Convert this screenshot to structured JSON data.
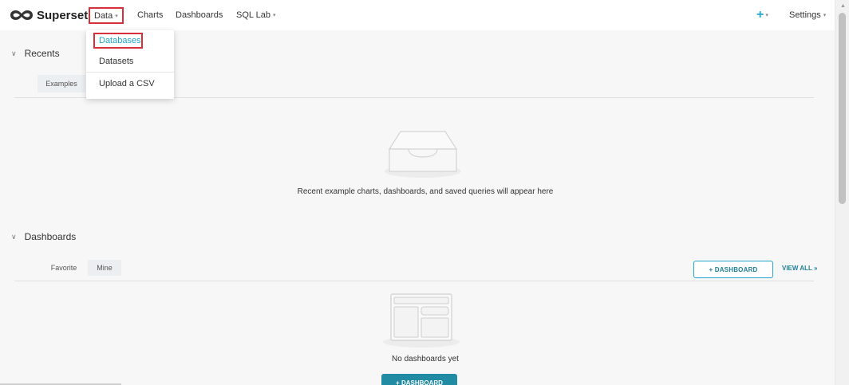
{
  "navbar": {
    "brand": "Superset",
    "data_label": "Data",
    "charts_label": "Charts",
    "dashboards_label": "Dashboards",
    "sqllab_label": "SQL Lab",
    "plus_label": "+",
    "settings_label": "Settings",
    "caret": "▾"
  },
  "data_menu": {
    "items": [
      "Databases",
      "Datasets",
      "Upload a CSV"
    ]
  },
  "recents": {
    "title": "Recents",
    "tabs": [
      "Examples"
    ],
    "empty_message": "Recent example charts, dashboards, and saved queries will appear here"
  },
  "dashboards": {
    "title": "Dashboards",
    "tabs": [
      "Favorite",
      "Mine"
    ],
    "add_button": "+ DASHBOARD",
    "view_all": "VIEW ALL »",
    "empty_message": "No dashboards yet",
    "empty_button": "+ DASHBOARD"
  },
  "colors": {
    "accent": "#20a7c9",
    "accent_dark": "#1f7f99",
    "highlight_box": "#d6303a"
  }
}
